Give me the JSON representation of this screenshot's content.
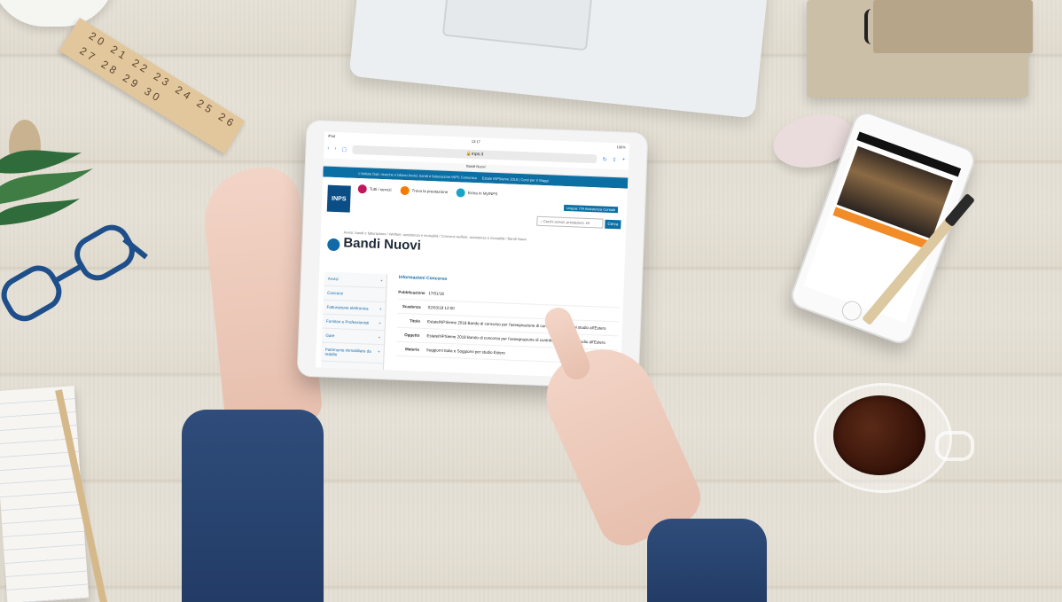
{
  "tablet": {
    "statusbar": {
      "device": "iPad",
      "time": "13:17",
      "battery": "100%"
    },
    "tab_title": "Bandi Nuovi",
    "url": "inps.it",
    "topbar": {
      "text": "L'Istituto  Dati, ricerche e bilanci  Avvisi, bandi e fatturazione  INPS Comunica",
      "right": "Estate INPSieme 2018 | Corsi per il Viaggi"
    },
    "logo": "INPS",
    "nav": {
      "all_services": "Tutti i servizi",
      "find_service": "Trova la prestazione",
      "myinps": "Entra in MyINPS"
    },
    "lang_links": "Lingua: ITA  Assistenza  Contatti",
    "search": {
      "placeholder": "Cerchi servizi, prestazioni, inf",
      "button": "Cerca"
    },
    "breadcrumb": "Avvisi, bandi e fatturazione / Welfare, assistenza e mutualità / Concorsi welfare, assistenza e mutualità / Bandi Nuovi",
    "page_title": "Bandi Nuovi",
    "sidebar": [
      {
        "label": "Avvisi",
        "sign": "+"
      },
      {
        "label": "Concorsi",
        "sign": ""
      },
      {
        "label": "Fatturazione elettronica",
        "sign": "+"
      },
      {
        "label": "Fornitori e Professionisti",
        "sign": "+"
      },
      {
        "label": "Gare",
        "sign": "+"
      },
      {
        "label": "Patrimonio immobiliare da reddito",
        "sign": "+"
      }
    ],
    "panel": {
      "heading": "Informazioni Concorso",
      "rows": [
        {
          "k": "Pubblicazione",
          "v": "17/01/18"
        },
        {
          "k": "Scadenza",
          "v": "02/03/18 12:00"
        },
        {
          "k": "Titolo",
          "v": "EstateINPSieme 2018 Bando di concorso per l'assegnazione di contribut... Soggiorni studio all'Estero"
        },
        {
          "k": "Oggetto",
          "v": "EstateINPSieme 2018 Bando di concorso per l'assegnazione di contribut... Soggiorni studio all'Estero"
        },
        {
          "k": "Materia",
          "v": "Soggiorni Italia e Soggiorni per studio Estero"
        }
      ]
    }
  },
  "ruler_marks": "20 21 22 23 24 25 26 27 28 29 30"
}
